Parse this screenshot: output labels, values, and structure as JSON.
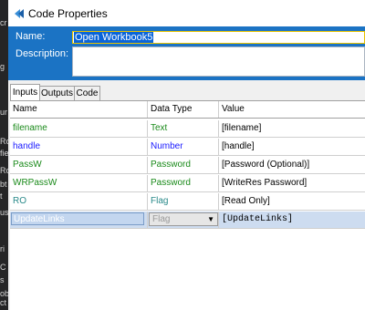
{
  "window": {
    "title": "Code Properties"
  },
  "header": {
    "name_label": "Name:",
    "name_value": "Open Workbook5",
    "description_label": "Description:"
  },
  "tabs": [
    {
      "label": "Inputs",
      "active": true
    },
    {
      "label": "Outputs",
      "active": false
    },
    {
      "label": "Code",
      "active": false
    }
  ],
  "grid": {
    "columns": [
      "Name",
      "Data Type",
      "Value"
    ],
    "rows": [
      {
        "name": "filename",
        "name_color": "#1a8a1a",
        "type": "Text",
        "type_color": "#1a8a1a",
        "value": "[filename]"
      },
      {
        "name": "handle",
        "name_color": "#1a1aff",
        "type": "Number",
        "type_color": "#1a1aff",
        "value": "[handle]"
      },
      {
        "name": "PassW",
        "name_color": "#1a8a1a",
        "type": "Password",
        "type_color": "#1a8a1a",
        "value": "[Password (Optional)]"
      },
      {
        "name": "WRPassW",
        "name_color": "#1a8a1a",
        "type": "Password",
        "type_color": "#1a8a1a",
        "value": "[WriteRes Password]"
      },
      {
        "name": "RO",
        "name_color": "#2a8a8a",
        "type": "Flag",
        "type_color": "#2a8a8a",
        "value": "[Read Only]"
      },
      {
        "name": "UpdateLinks",
        "name_color": "#ffffff",
        "type": "Flag",
        "type_color": "#9a9a9a",
        "value": "[UpdateLinks]"
      }
    ]
  },
  "left_strip_fragments": [
    "cr",
    "g",
    "ur",
    "Rc",
    "fie",
    "Rc",
    "bt",
    "t",
    "us",
    "ri",
    "C",
    "s",
    "ob",
    "ct"
  ]
}
